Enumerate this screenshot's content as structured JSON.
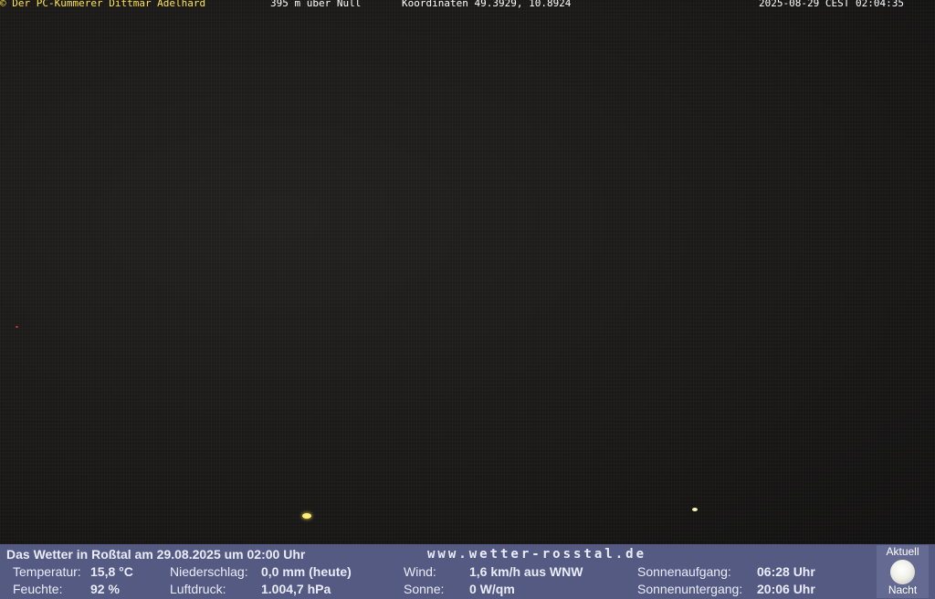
{
  "overlay": {
    "copyright": "© Der PC-Kümmerer Dittmar Adelhard",
    "altitude": "395 m über Null",
    "coordinates": "Koordinaten 49.3929, 10.8924",
    "datetime": "2025-08-29 CEST 02:04:35"
  },
  "footer": {
    "title": "Das Wetter in Roßtal am 29.08.2025 um 02:00 Uhr",
    "website": "www.wetter-rosstal.de",
    "rows": [
      [
        {
          "label": "Temperatur:",
          "value": "15,8 °C"
        },
        {
          "label": "Niederschlag:",
          "value": "0,0 mm (heute)"
        },
        {
          "label": "Wind:",
          "value": "1,6 km/h aus WNW"
        },
        {
          "label": "Sonnenaufgang:",
          "value": "06:28 Uhr"
        }
      ],
      [
        {
          "label": "Feuchte:",
          "value": "92 %"
        },
        {
          "label": "Luftdruck:",
          "value": "1.004,7 hPa"
        },
        {
          "label": "Sonne:",
          "value": "0 W/qm"
        },
        {
          "label": "Sonnenuntergang:",
          "value": "20:06 Uhr"
        }
      ]
    ],
    "moon": {
      "top_label": "Aktuell",
      "bottom_label": "Nacht",
      "icon": "full-moon-icon"
    }
  }
}
